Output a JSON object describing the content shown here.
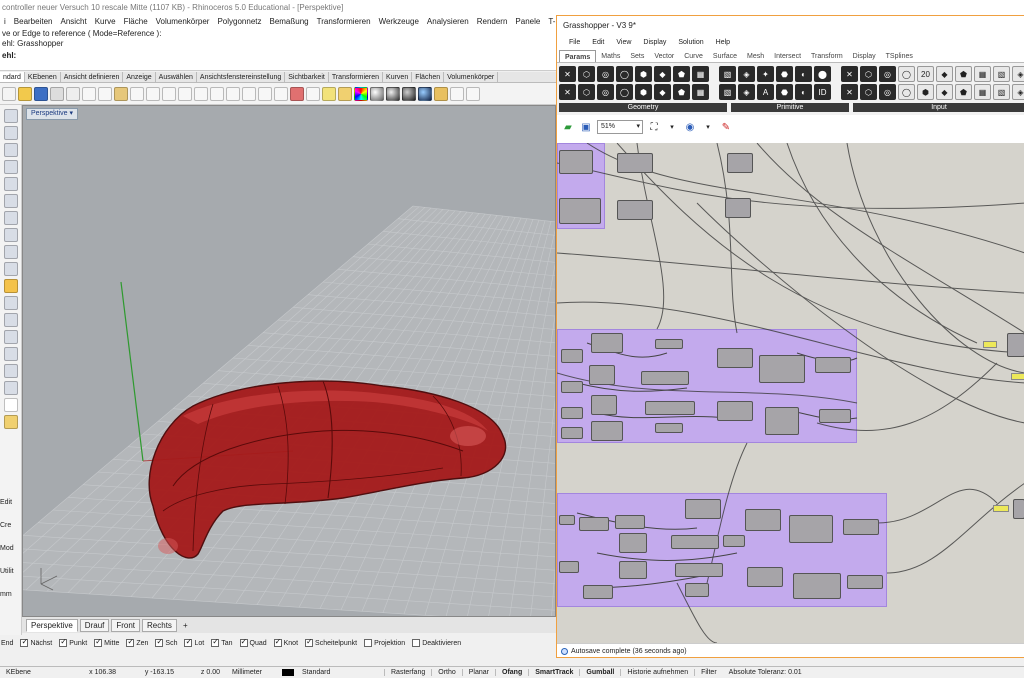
{
  "rhino": {
    "title": "controller neuer Versuch 10 rescale Mitte (1107 KB) - Rhinoceros 5.0 Educational - [Perspektive]",
    "menu": [
      "i",
      "Bearbeiten",
      "Ansicht",
      "Kurve",
      "Fläche",
      "Volumenkörper",
      "Polygonnetz",
      "Bemaßung",
      "Transformieren",
      "Werkzeuge",
      "Analysieren",
      "Rendern",
      "Panele",
      "T-S"
    ],
    "command_history": [
      "ve or Edge to reference ( Mode=Reference ):",
      "ehl: Grasshopper"
    ],
    "command_prompt": "ehl:",
    "toolbar_tabs": [
      "ndard",
      "KEbenen",
      "Ansicht definieren",
      "Anzeige",
      "Auswählen",
      "Ansichtsfenstereinstellung",
      "Sichtbarkeit",
      "Transformieren",
      "Kurven",
      "Flächen",
      "Volumenkörper"
    ],
    "viewport_label": "Perspektive",
    "viewport_tabs": [
      "Perspektive",
      "Drauf",
      "Front",
      "Rechts",
      "+"
    ],
    "left_panel_labels": [
      "Edit",
      "Cre",
      "Mod",
      "Utilit",
      "mm"
    ],
    "osnaps": [
      {
        "label": "End",
        "checked": false
      },
      {
        "label": "Nächst",
        "checked": true
      },
      {
        "label": "Punkt",
        "checked": true
      },
      {
        "label": "Mitte",
        "checked": true
      },
      {
        "label": "Zen",
        "checked": true
      },
      {
        "label": "Sch",
        "checked": true
      },
      {
        "label": "Lot",
        "checked": true
      },
      {
        "label": "Tan",
        "checked": true
      },
      {
        "label": "Quad",
        "checked": true
      },
      {
        "label": "Knot",
        "checked": true
      },
      {
        "label": "Scheitelpunkt",
        "checked": true
      },
      {
        "label": "Projektion",
        "checked": false
      },
      {
        "label": "Deaktivieren",
        "checked": false
      }
    ],
    "status": {
      "layer": "KEbene",
      "x": "x 106.38",
      "y": "y -163.15",
      "z": "z 0.00",
      "units": "Millimeter",
      "layer_name": "Standard",
      "modes": [
        "Rasterfang",
        "Ortho",
        "Planar",
        "Ofang",
        "SmartTrack",
        "Gumball",
        "Historie aufnehmen",
        "Filter"
      ],
      "bold_modes": [
        "Ofang",
        "SmartTrack",
        "Gumball"
      ],
      "tolerance": "Absolute Toleranz: 0.01"
    }
  },
  "grasshopper": {
    "title": "Grasshopper - V3 9*",
    "menu": [
      "File",
      "Edit",
      "View",
      "Display",
      "Solution",
      "Help"
    ],
    "tabs": [
      "Params",
      "Maths",
      "Sets",
      "Vector",
      "Curve",
      "Surface",
      "Mesh",
      "Intersect",
      "Transform",
      "Display",
      "TSplines"
    ],
    "active_tab": "Params",
    "ribbon_groups": [
      "Geometry",
      "Primitive",
      "Input"
    ],
    "ribbon_text_icons": [
      "A",
      "ID",
      "20"
    ],
    "zoom": "51%",
    "status": "Autosave complete (36 seconds ago)"
  },
  "colors": {
    "cluster_purple": "#c0a6f5",
    "model_red": "#b01818",
    "gh_canvas": "#d5d3cc",
    "viewport_bg": "#a6aaae",
    "window_border": "#f0a040"
  }
}
